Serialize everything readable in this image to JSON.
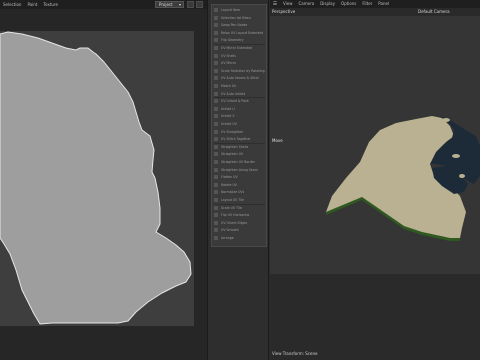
{
  "uv_editor": {
    "menu": [
      "Selection",
      "Paint",
      "Texture"
    ],
    "project_select": "Project"
  },
  "list_panel": {
    "items": [
      "Layout Item",
      "Selection list Blend",
      "Swap Pen Nodes",
      "Relax UV Layout Extended",
      "Flip Geometry",
      "UV Mirror Extended",
      "UV Shells",
      "UV Mirror",
      "Scale Selection by Rotating",
      "UV Auto Seams & Stitch",
      "Match UV",
      "UV Auto Unfold",
      "UV Unfold & Pack",
      "Unfold U",
      "Unfold V",
      "Unfold UV",
      "UV Straighten",
      "UV Stitch Together",
      "Straighten Shells",
      "Straighten UV",
      "Straighten UV Border",
      "Straighten Along Seam",
      "Flatten UV",
      "Rotate UV",
      "Normalize UVs",
      "Layout UV Tile",
      "Scale UV Tile",
      "Flip UV Horizontal",
      "UV Orient Edges",
      "UV Smooth",
      "Arrange"
    ]
  },
  "viewport": {
    "menu": [
      "View",
      "Camera",
      "Display",
      "Options",
      "Filter",
      "Panel"
    ],
    "hamburger": "☰",
    "camera_mode": "Perspective",
    "camera_name": "Default Camera",
    "tool_label": "Move",
    "status": "View Transform: Scene"
  },
  "colors": {
    "uv_shell_fill": "#9e9e9e",
    "uv_shell_outline": "#e6e6e6",
    "terrain_land": "#b9b191",
    "terrain_water": "#1d2b38",
    "terrain_side": "#2f5a1f"
  }
}
